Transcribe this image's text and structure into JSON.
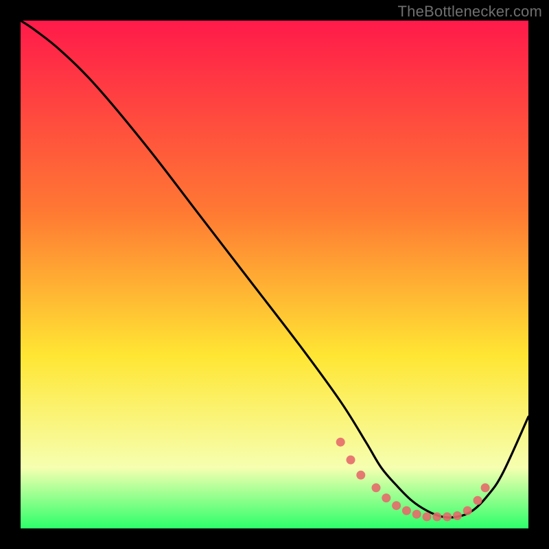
{
  "watermark": "TheBottlenecker.com",
  "colors": {
    "background": "#000000",
    "curve": "#000000",
    "marker": "#e66a6a",
    "grad_top": "#ff1a4a",
    "grad_mid1": "#ff7a33",
    "grad_mid2": "#ffe633",
    "grad_mid3": "#f6ffb0",
    "grad_bottom": "#2dff6a"
  },
  "chart_data": {
    "type": "line",
    "title": "",
    "xlabel": "",
    "ylabel": "",
    "xlim": [
      0,
      100
    ],
    "ylim": [
      0,
      100
    ],
    "series": [
      {
        "name": "curve",
        "x": [
          0,
          3,
          8,
          15,
          25,
          35,
          45,
          55,
          63,
          68,
          71,
          74,
          77,
          80,
          83,
          86,
          89,
          92,
          95,
          100
        ],
        "y": [
          100,
          98,
          94,
          87,
          75,
          62,
          49,
          36,
          25,
          17,
          12,
          8.5,
          5.5,
          3.5,
          2.3,
          2.3,
          3.5,
          6.5,
          11,
          22
        ]
      }
    ],
    "markers": {
      "x": [
        63,
        65,
        67,
        70,
        72,
        74,
        76,
        78,
        80,
        82,
        84,
        86,
        88,
        90,
        91.5
      ],
      "y": [
        17,
        13.5,
        10.5,
        8,
        6,
        4.5,
        3.5,
        2.8,
        2.3,
        2.3,
        2.3,
        2.5,
        3.5,
        5.5,
        8
      ]
    }
  }
}
